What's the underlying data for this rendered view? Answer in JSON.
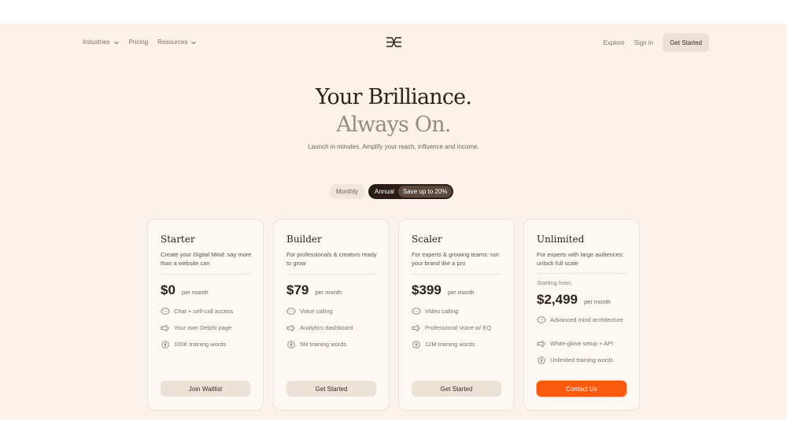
{
  "nav": {
    "left": [
      {
        "label": "Industries",
        "dropdown": true
      },
      {
        "label": "Pricing",
        "dropdown": false
      },
      {
        "label": "Resources",
        "dropdown": true
      }
    ],
    "explore": "Explore",
    "signin": "Sign in",
    "cta": "Get Started"
  },
  "hero": {
    "line1": "Your Brilliance.",
    "line2": "Always On.",
    "subtitle": "Launch in minutes. Amplify your reach, influence and income."
  },
  "billing": {
    "monthly": "Monthly",
    "annual": "Annual",
    "badge": "Save up to 20%",
    "selected": "Annual"
  },
  "plans": [
    {
      "name": "Starter",
      "description": "Create your Digital Mind: say more than a website can",
      "starting": "",
      "price": "$0",
      "per": "per month",
      "features": [
        {
          "icon": "chat-bubble-icon",
          "text": "Chat + self-call access"
        },
        {
          "icon": "megaphone-icon",
          "text": "Your own Delphi page"
        },
        {
          "icon": "feather-icon",
          "text": "100K training words"
        }
      ],
      "button": "Join Waitlist",
      "primary": false
    },
    {
      "name": "Builder",
      "description": "For professionals & creators ready to grow",
      "starting": "",
      "price": "$79",
      "per": "per month",
      "features": [
        {
          "icon": "chat-bubble-icon",
          "text": "Voice calling"
        },
        {
          "icon": "megaphone-icon",
          "text": "Analytics dashboard"
        },
        {
          "icon": "feather-icon",
          "text": "5M training words"
        }
      ],
      "button": "Get Started",
      "primary": false
    },
    {
      "name": "Scaler",
      "description": "For experts & growing teams: run your brand like a pro",
      "starting": "",
      "price": "$399",
      "per": "per month",
      "features": [
        {
          "icon": "chat-bubble-icon",
          "text": "Video calling"
        },
        {
          "icon": "megaphone-icon",
          "text": "Professional Voice w/ EQ"
        },
        {
          "icon": "feather-icon",
          "text": "12M training words"
        }
      ],
      "button": "Get Started",
      "primary": false
    },
    {
      "name": "Unlimited",
      "description": "For experts with large audiences: unlock full scale",
      "starting": "Starting from:",
      "price": "$2,499",
      "per": "per month",
      "features": [
        {
          "icon": "chat-bubble-icon",
          "text": "Advanced mind architecture"
        },
        {
          "icon": "megaphone-icon",
          "text": "White-glove setup + API"
        },
        {
          "icon": "feather-icon",
          "text": "Unlimited training words"
        }
      ],
      "button": "Contact Us",
      "primary": true
    }
  ],
  "colors": {
    "page_bg": "#fbf3eb",
    "accent": "#fa5a0f",
    "dark": "#2b1d15"
  }
}
